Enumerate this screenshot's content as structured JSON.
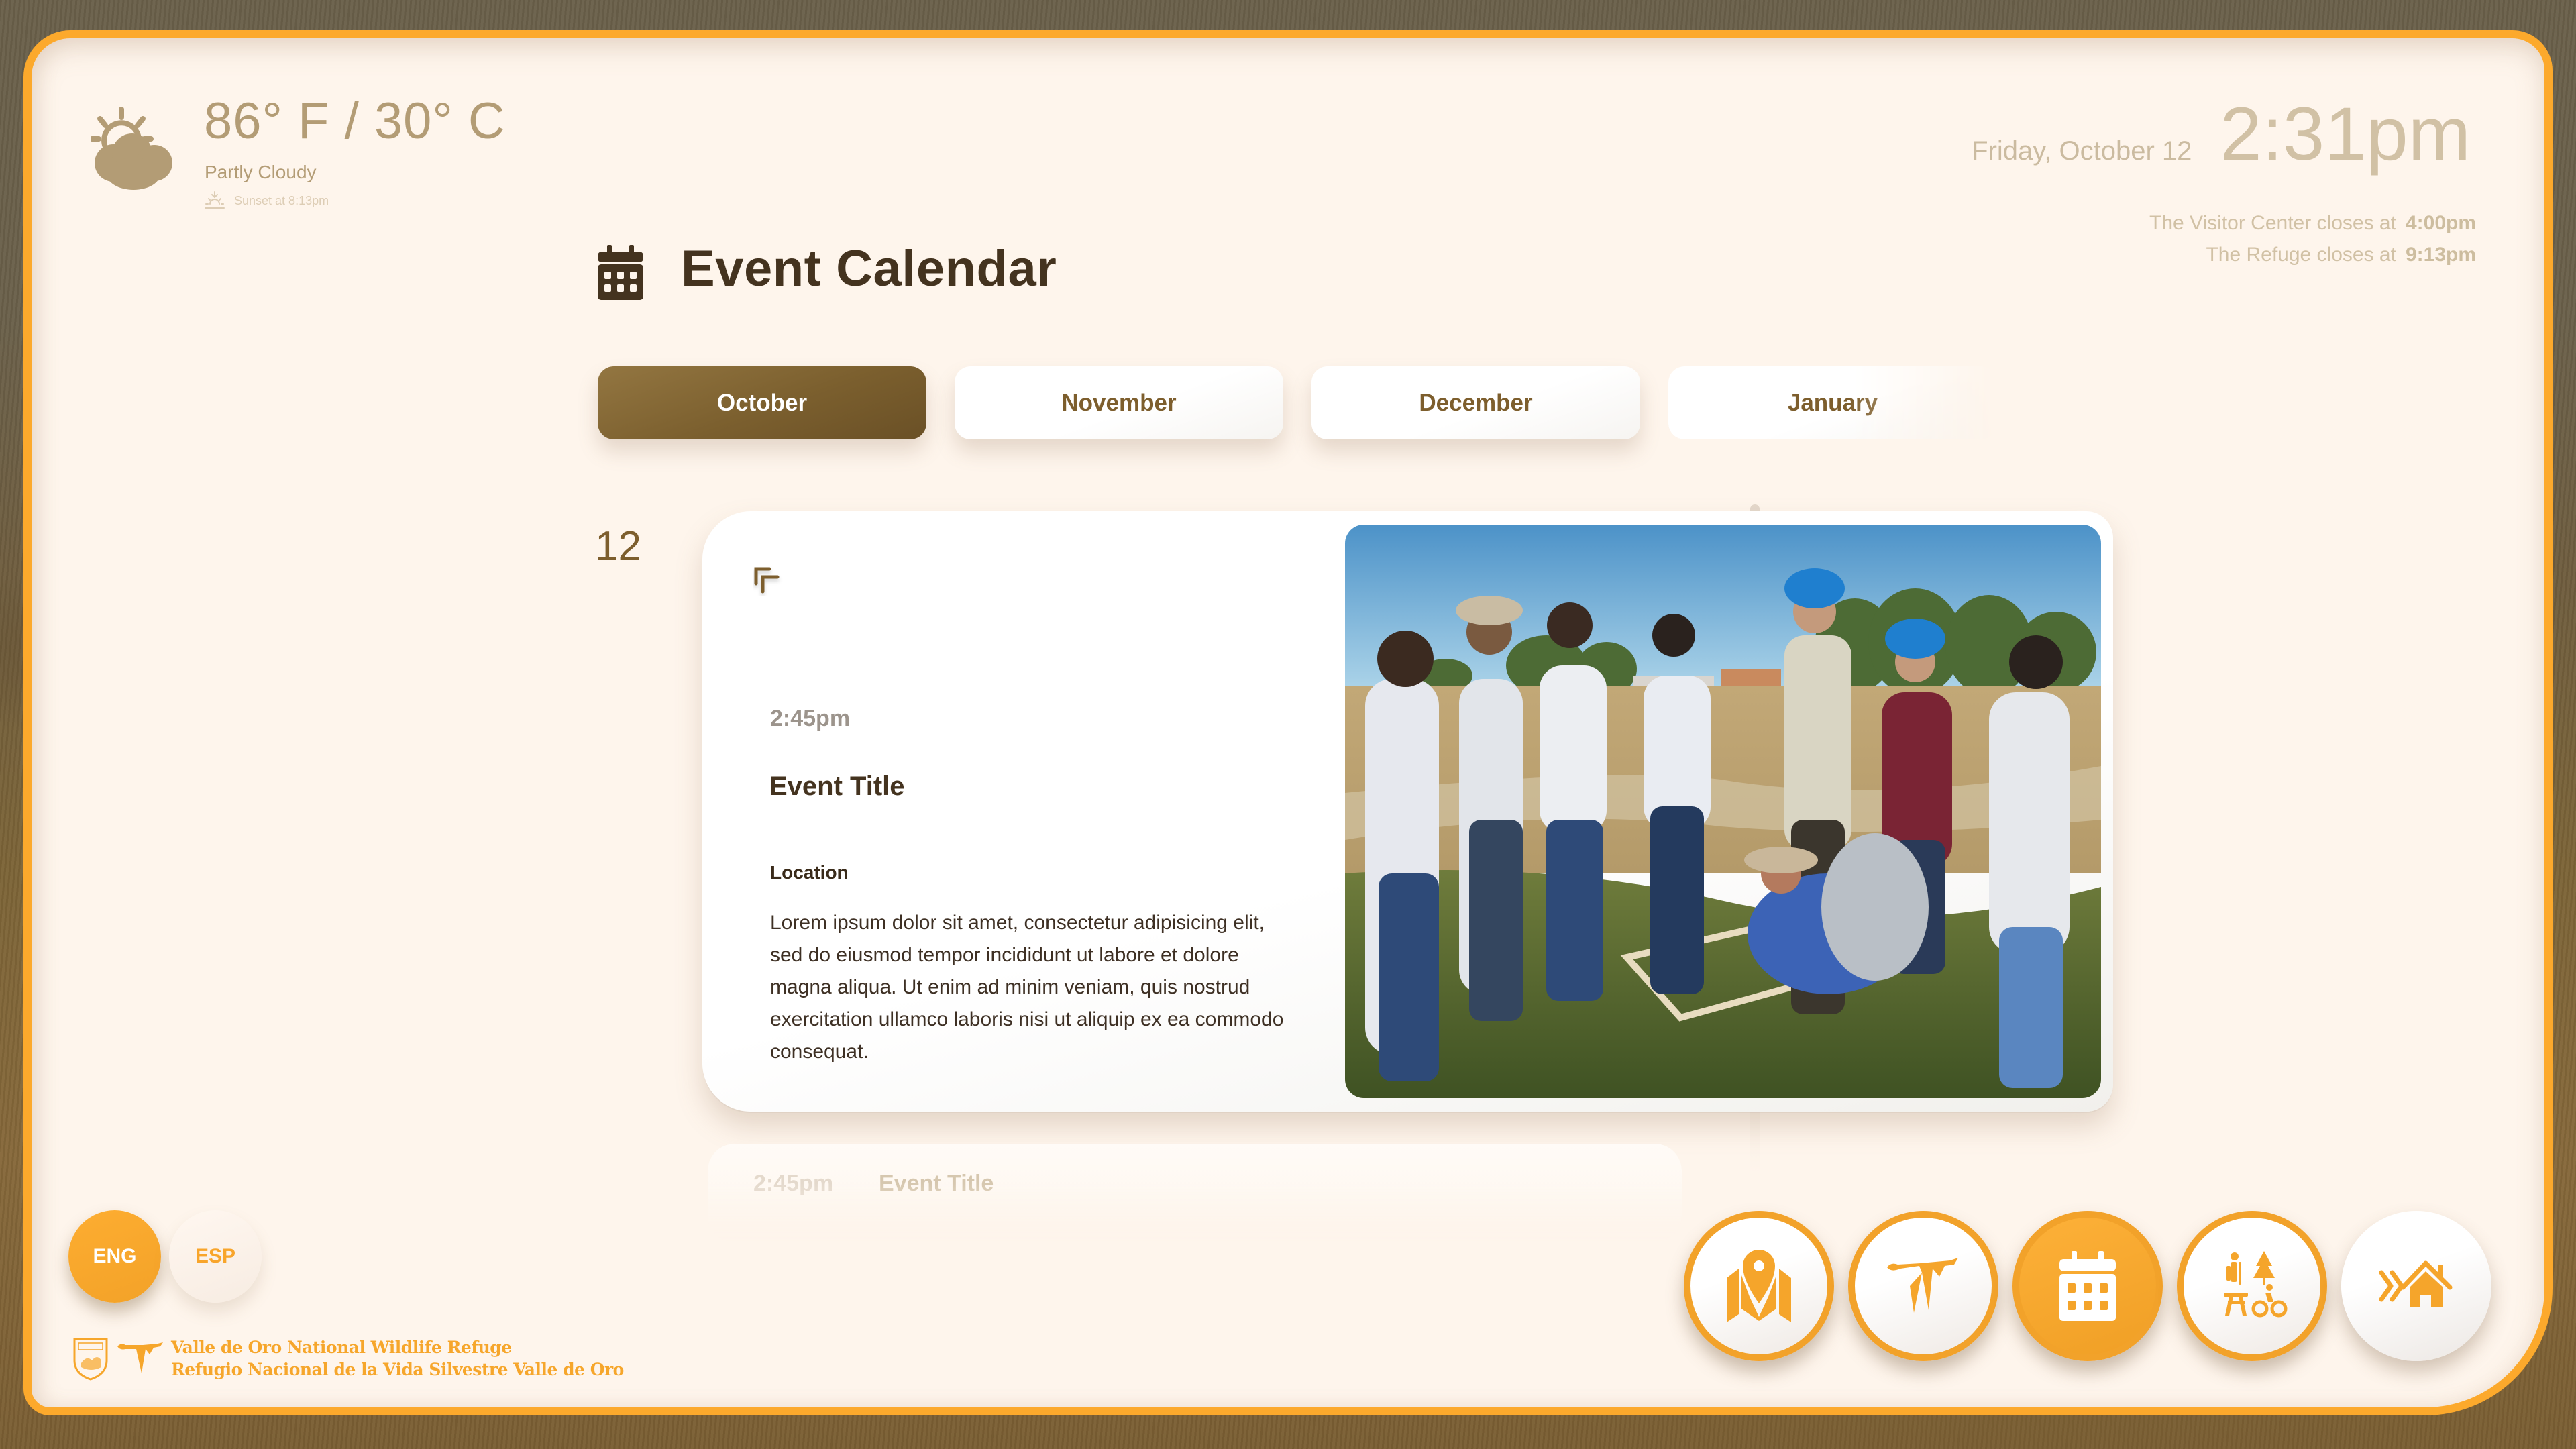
{
  "colors": {
    "accent_orange": "#fca92c",
    "brand_brown": "#7d5e2d",
    "title_dark": "#44331f",
    "panel_bg": "#fef5ec"
  },
  "weather": {
    "icon": "partly-cloudy-icon",
    "temperature": "86° F / 30° C",
    "condition": "Partly Cloudy",
    "sunset_icon": "sunset-icon",
    "sunset": "Sunset at 8:13pm"
  },
  "clock": {
    "date": "Friday, October 12",
    "time": "2:31pm"
  },
  "closing_times": [
    {
      "label": "The Visitor Center closes at",
      "time": "4:00pm"
    },
    {
      "label": "The Refuge closes at",
      "time": "9:13pm"
    }
  ],
  "header": {
    "icon": "calendar-icon",
    "title": "Event Calendar"
  },
  "month_tabs": [
    {
      "label": "October",
      "active": true
    },
    {
      "label": "November",
      "active": false
    },
    {
      "label": "December",
      "active": false
    },
    {
      "label": "January",
      "active": false
    }
  ],
  "day": {
    "number": "12",
    "events": [
      {
        "time": "2:45pm",
        "title": "Event Title",
        "location_label": "Location",
        "description": "Lorem ipsum dolor sit amet, consectetur adipisicing elit, sed do eiusmod tempor incididunt ut labore et dolore magna aliqua. Ut enim ad minim veniam, quis nostrud exercitation ullamco laboris nisi ut aliquip ex ea commodo consequat.",
        "expand_icon": "expand-icon",
        "photo": "Group of volunteers and refuge staff standing around a wooden survey quadrat in a grassy field"
      },
      {
        "time": "2:45pm",
        "title": "Event Title"
      }
    ]
  },
  "language": {
    "options": [
      {
        "label": "ENG",
        "active": true
      },
      {
        "label": "ESP",
        "active": false
      }
    ]
  },
  "logo": {
    "line1": "Valle de Oro National Wildlife Refuge",
    "line2": "Refugio Nacional de la Vida Silvestre Valle de Oro"
  },
  "nav": [
    {
      "name": "map",
      "icon": "map-pin-icon",
      "active": false
    },
    {
      "name": "wildlife",
      "icon": "bird-icon",
      "active": false
    },
    {
      "name": "events",
      "icon": "calendar-icon",
      "active": true
    },
    {
      "name": "activities",
      "icon": "activities-icon",
      "active": false
    },
    {
      "name": "home",
      "icon": "home-icon",
      "active": false
    }
  ]
}
